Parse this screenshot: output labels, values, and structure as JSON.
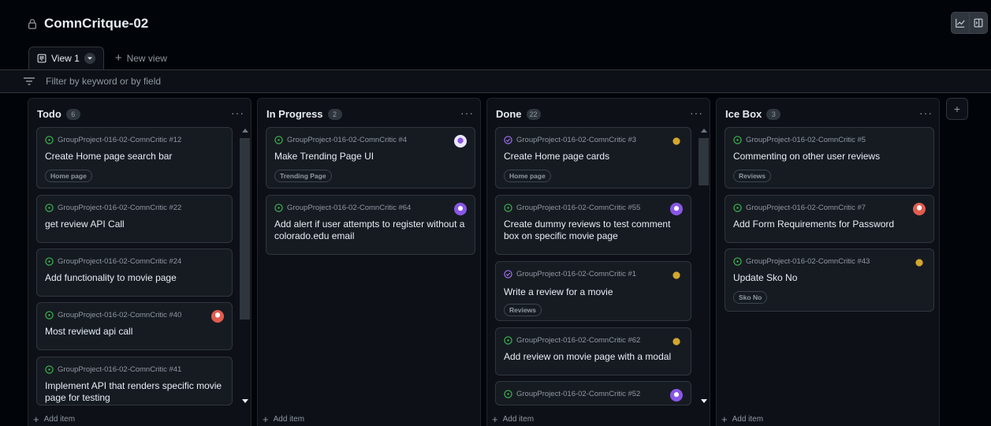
{
  "header": {
    "project_title": "ComnCritque-02",
    "icons": [
      "lock-icon",
      "insights-icon",
      "side-panel-icon"
    ]
  },
  "tabs": [
    {
      "label": "View 1",
      "icon": "board-icon"
    },
    {
      "label": "New view",
      "icon": "plus-icon"
    }
  ],
  "filter": {
    "placeholder": "Filter by keyword or by field"
  },
  "add_item_label": "Add item",
  "columns": [
    {
      "name": "Todo",
      "count": "6",
      "cards": [
        {
          "repo": "GroupProject-016-02-ComnCritic #12",
          "title": "Create Home page search bar",
          "label": "Home page",
          "status": "open"
        },
        {
          "repo": "GroupProject-016-02-ComnCritic #22",
          "title": "get review API Call",
          "status": "open"
        },
        {
          "repo": "GroupProject-016-02-ComnCritic #24",
          "title": "Add functionality to movie page",
          "status": "open"
        },
        {
          "repo": "GroupProject-016-02-ComnCritic #40",
          "title": "Most reviewd api call",
          "status": "open",
          "avatar": "avatar-red"
        },
        {
          "repo": "GroupProject-016-02-ComnCritic #41",
          "title": "Implement API that renders specific movie page for testing",
          "status": "open"
        }
      ]
    },
    {
      "name": "In Progress",
      "count": "2",
      "cards": [
        {
          "repo": "GroupProject-016-02-ComnCritic #4",
          "title": "Make Trending Page UI",
          "label": "Trending Page",
          "status": "open",
          "avatar": "avatar-purple-light"
        },
        {
          "repo": "GroupProject-016-02-ComnCritic #64",
          "title": "Add alert if user attempts to register without a colorado.edu email",
          "status": "open",
          "avatar": "avatar-purple"
        }
      ]
    },
    {
      "name": "Done",
      "count": "22",
      "cards": [
        {
          "repo": "GroupProject-016-02-ComnCritic #3",
          "title": "Create Home page cards",
          "label": "Home page",
          "status": "closed",
          "avatar": "avatar-yellow"
        },
        {
          "repo": "GroupProject-016-02-ComnCritic #55",
          "title": "Create dummy reviews to test comment box on specific movie page",
          "status": "open",
          "avatar": "avatar-purple"
        },
        {
          "repo": "GroupProject-016-02-ComnCritic #1",
          "title": "Write a review for a movie",
          "label": "Reviews",
          "status": "closed",
          "avatar": "avatar-yellow"
        },
        {
          "repo": "GroupProject-016-02-ComnCritic #62",
          "title": "Add review on movie page with a modal",
          "status": "open",
          "avatar": "avatar-yellow"
        },
        {
          "repo": "GroupProject-016-02-ComnCritic #52",
          "title": "",
          "status": "open",
          "avatar": "avatar-purple"
        }
      ]
    },
    {
      "name": "Ice Box",
      "count": "3",
      "cards": [
        {
          "repo": "GroupProject-016-02-ComnCritic #5",
          "title": "Commenting on other user reviews",
          "label": "Reviews",
          "status": "open"
        },
        {
          "repo": "GroupProject-016-02-ComnCritic #7",
          "title": "Add Form Requirements for Password",
          "status": "open",
          "avatar": "avatar-red"
        },
        {
          "repo": "GroupProject-016-02-ComnCritic #43",
          "title": "Update Sko No",
          "label": "Sko No",
          "status": "open",
          "avatar": "avatar-yellow"
        }
      ]
    }
  ],
  "colors": {
    "open_issue": "#3fb950",
    "closed_issue": "#a371f7",
    "background": "#010409",
    "column": "#0d1117",
    "card": "#161b22",
    "border": "#30363d"
  }
}
